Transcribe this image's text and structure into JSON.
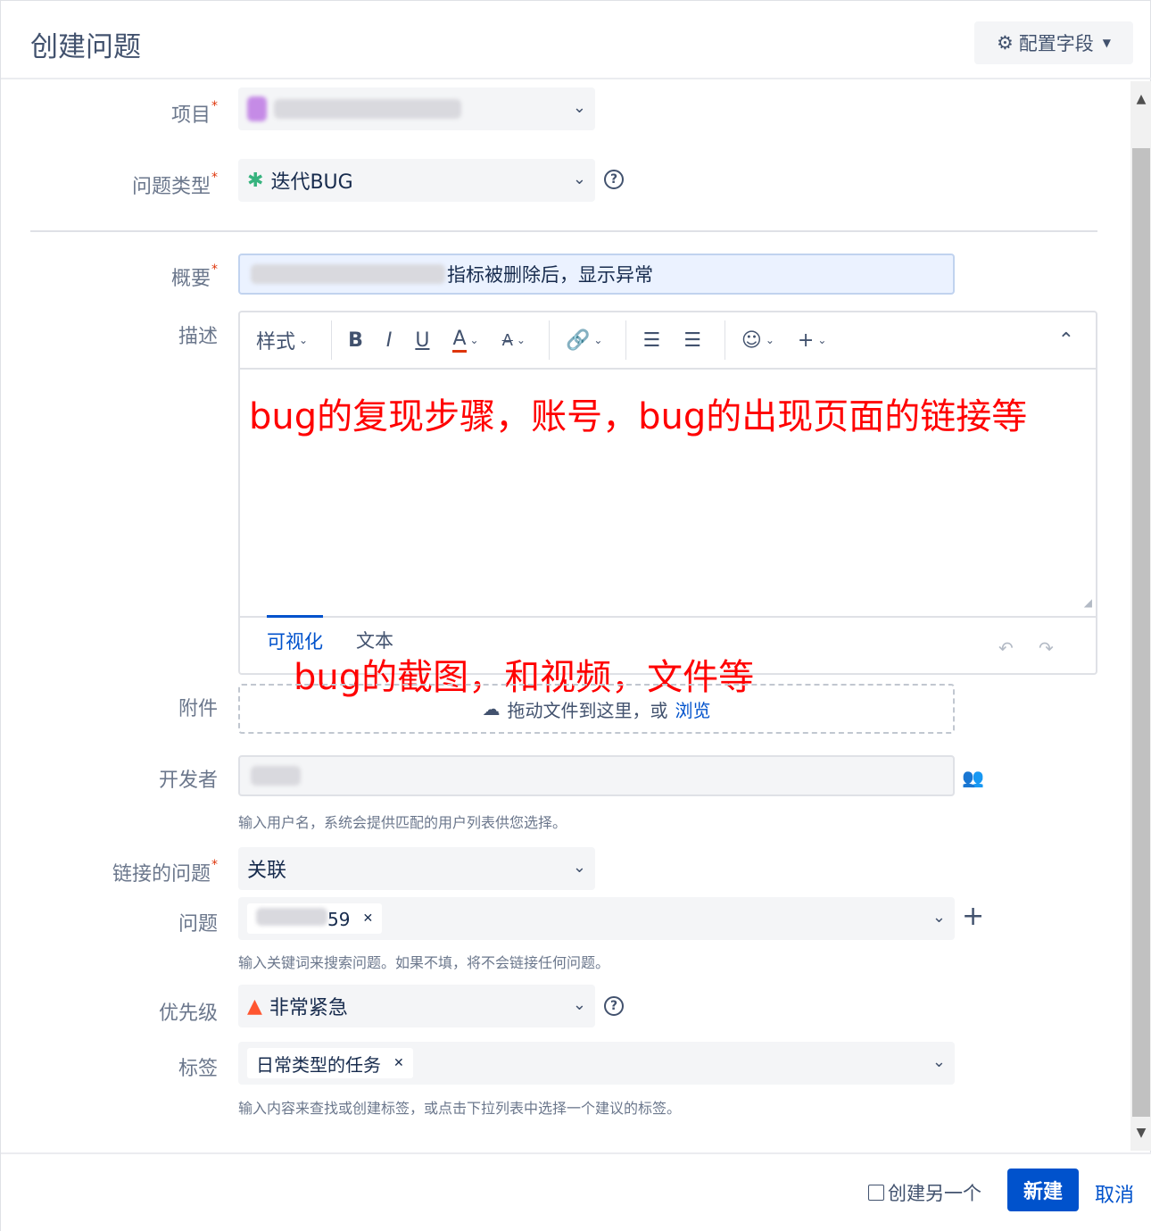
{
  "header": {
    "title": "创建问题",
    "config_label": "配置字段"
  },
  "fields": {
    "project": {
      "label": "项目",
      "required": "*"
    },
    "issue_type": {
      "label": "问题类型",
      "required": "*",
      "value": "迭代BUG"
    },
    "summary": {
      "label": "概要",
      "required": "*",
      "value": "指标被删除后，显示异常"
    },
    "description": {
      "label": "描述",
      "toolbar": {
        "style": "样式",
        "bold": "B",
        "italic": "I",
        "underline": "U",
        "text_color": "A",
        "clear_format": "A",
        "link": "🔗",
        "bullet_list": "☰",
        "number_list": "☰",
        "emoji": "☺",
        "insert": "+",
        "collapse": "⌃"
      },
      "content": "bug的复现步骤，账号，bug的出现页面的链接等",
      "tabs": [
        "可视化",
        "文本"
      ]
    },
    "attachment": {
      "label": "附件",
      "drop_text": "拖动文件到这里，或",
      "browse": "浏览",
      "annotation": "bug的截图，和视频，文件等"
    },
    "developer": {
      "label": "开发者",
      "hint": "输入用户名，系统会提供匹配的用户列表供您选择。"
    },
    "linked_issues": {
      "label": "链接的问题",
      "required": "*",
      "value": "关联"
    },
    "issue": {
      "label": "问题",
      "chip_suffix": "59",
      "hint": "输入关键词来搜索问题。如果不填，将不会链接任何问题。"
    },
    "priority": {
      "label": "优先级",
      "value": "非常紧急"
    },
    "labels": {
      "label": "标签",
      "chip": "日常类型的任务",
      "hint": "输入内容来查找或创建标签，或点击下拉列表中选择一个建议的标签。"
    }
  },
  "footer": {
    "create_another": "创建另一个",
    "submit": "新建",
    "cancel": "取消"
  },
  "colors": {
    "accent": "#0052cc",
    "annotation": "#ff0000",
    "required": "#de350b"
  }
}
